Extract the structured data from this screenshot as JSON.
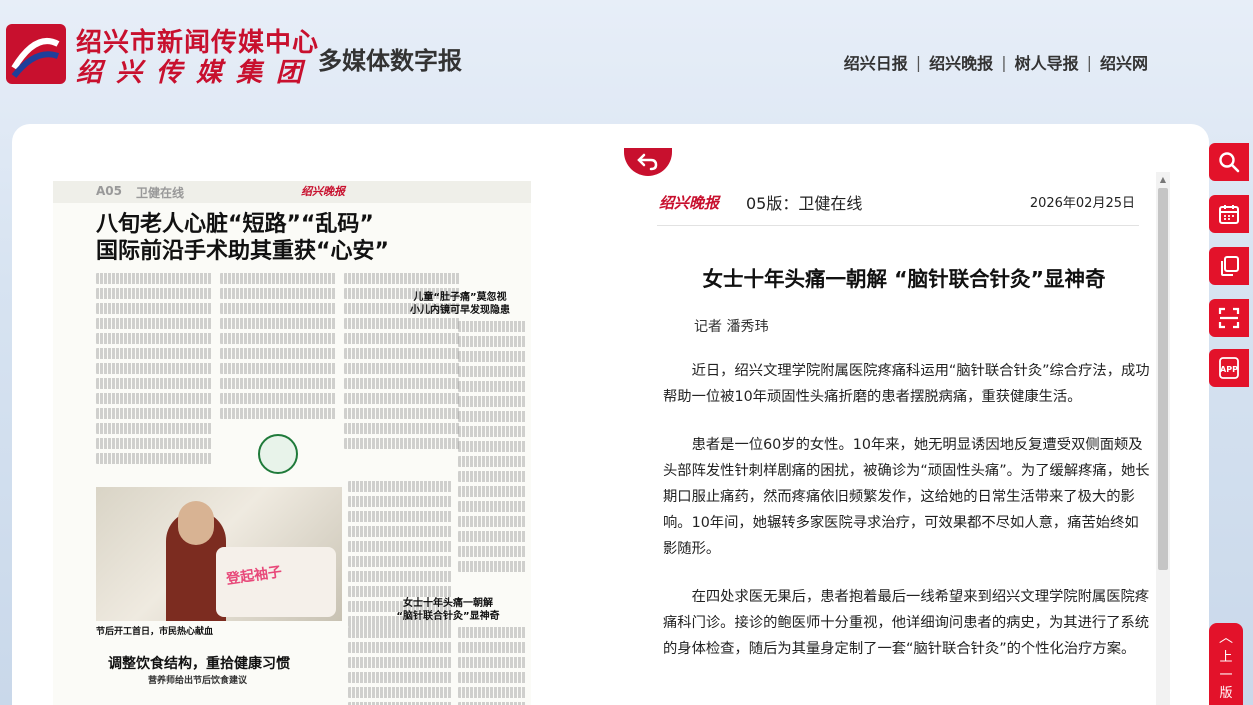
{
  "header": {
    "brand_line1": "绍兴市新闻传媒中心",
    "brand_line2": "绍兴传媒集团",
    "brand_sub": "多媒体数字报",
    "nav": [
      "绍兴日报",
      "绍兴晚报",
      "树人导报",
      "绍兴网"
    ]
  },
  "paper": {
    "section": "A05",
    "tag": "卫健在线",
    "brand": "绍兴晚报",
    "headline_line1": "八旬老人心脏“短路”“乱码”",
    "headline_line2": "国际前沿手术助其重获“心安”",
    "sub1_line1": "儿童“肚子痛”莫忽视",
    "sub1_line2": "小儿内镜可早发现隐患",
    "photo_slogan": "登起袖子",
    "photo_caption": "节后开工首日，市民热心献血",
    "sub2_line1": "女士十年头痛一朝解",
    "sub2_line2": "“脑针联合针灸”显神奇",
    "headline3": "调整饮食结构，重拾健康习惯",
    "sub3": "营养师给出节后饮食建议"
  },
  "article": {
    "brand": "绍兴晚报",
    "edition": "05版：卫健在线",
    "date": "2026年02月25日",
    "title": "女士十年头痛一朝解 “脑针联合针灸”显神奇",
    "author": "记者 潘秀玮",
    "paragraphs": [
      "近日，绍兴文理学院附属医院疼痛科运用“脑针联合针灸”综合疗法，成功帮助一位被10年顽固性头痛折磨的患者摆脱病痛，重获健康生活。",
      "患者是一位60岁的女性。10年来，她无明显诱因地反复遭受双侧面颊及头部阵发性针刺样剧痛的困扰，被确诊为“顽固性头痛”。为了缓解疼痛，她长期口服止痛药，然而疼痛依旧频繁发作，这给她的日常生活带来了极大的影响。10年间，她辗转多家医院寻求治疗，可效果都不尽如人意，痛苦始终如影随形。",
      "在四处求医无果后，患者抱着最后一线希望来到绍兴文理学院附属医院疼痛科门诊。接诊的鲍医师十分重视，他详细询问患者的病史，为其进行了系统的身体检查，随后为其量身定制了一套“脑针联合针灸”的个性化治疗方案。"
    ]
  },
  "tools": {
    "to_top_label": [
      "上",
      "一",
      "版"
    ],
    "icons": [
      "search-icon",
      "calendar-icon",
      "copy-icon",
      "scan-icon",
      "app-icon"
    ],
    "accent": "#e3122a"
  }
}
